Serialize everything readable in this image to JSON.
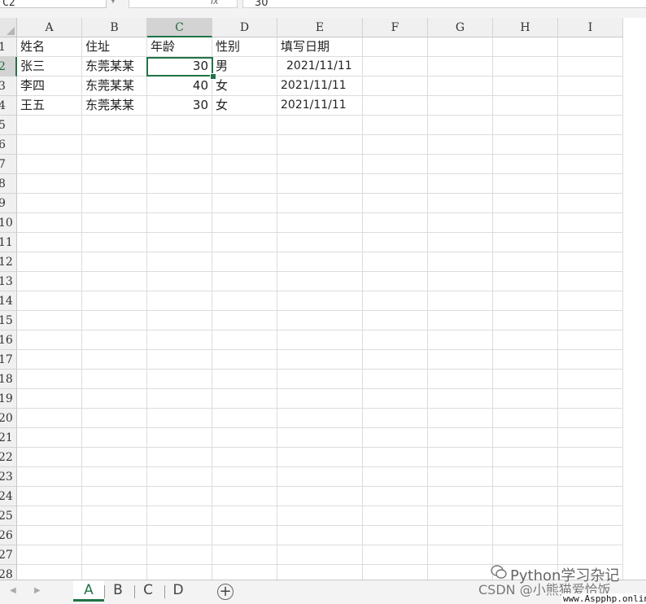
{
  "formula_bar": {
    "name_box": "C2",
    "fx_label": "fx",
    "value": "30"
  },
  "columns": [
    "A",
    "B",
    "C",
    "D",
    "E",
    "F",
    "G",
    "H",
    "I"
  ],
  "selected_column": "C",
  "rows": [
    "1",
    "2",
    "3",
    "4",
    "5",
    "6",
    "7",
    "8",
    "9",
    "10",
    "11",
    "12",
    "13",
    "14",
    "15",
    "16",
    "17",
    "18",
    "19",
    "20",
    "21",
    "22",
    "23",
    "24",
    "25",
    "26",
    "27",
    "28"
  ],
  "selected_row": "2",
  "table": [
    {
      "A": "姓名",
      "B": "住址",
      "C": "年龄",
      "D": "性别",
      "E": "填写日期"
    },
    {
      "A": "张三",
      "B": "东莞某某",
      "C": "30",
      "D": "男",
      "E": "2021/11/11"
    },
    {
      "A": "李四",
      "B": "东莞某某",
      "C": "40",
      "D": "女",
      "E": "2021/11/11"
    },
    {
      "A": "王五",
      "B": "东莞某某",
      "C": "30",
      "D": "女",
      "E": "2021/11/11"
    }
  ],
  "sheet_tabs": [
    "A",
    "B",
    "C",
    "D"
  ],
  "active_sheet": "A",
  "add_sheet_label": "+",
  "watermark": {
    "line1": "Python学习杂记",
    "line2": "CSDN @小熊猫爱恰饭",
    "line3": "www.Aspphp.online"
  },
  "colors": {
    "accent": "#217346",
    "header_bg": "#f0f0f0",
    "grid_line": "#dcdcdc"
  }
}
